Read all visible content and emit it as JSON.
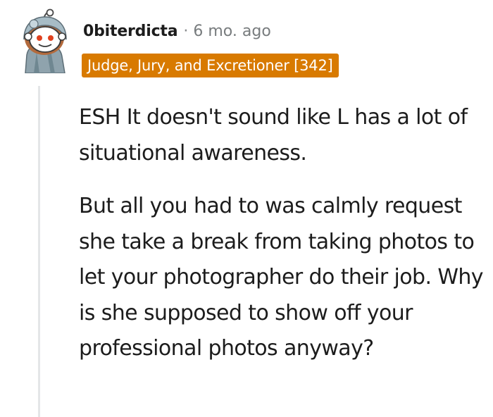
{
  "comment": {
    "username": "0biterdicta",
    "separator": "·",
    "time": "6 mo. ago",
    "flair": "Judge, Jury, and Excretioner [342]",
    "paragraphs": [
      "ESH It doesn't sound like L has a lot of situational awareness.",
      "But all you had to was calmly request she take a break from taking photos to let your photographer do their job. Why is she supposed to show off your professional photos anyway?"
    ]
  },
  "colors": {
    "flair_background": "#d87a00",
    "thread_line": "#e4e6e8",
    "meta_text": "#787c7e"
  },
  "icons": {
    "avatar": "snoo-avatar-icon"
  }
}
